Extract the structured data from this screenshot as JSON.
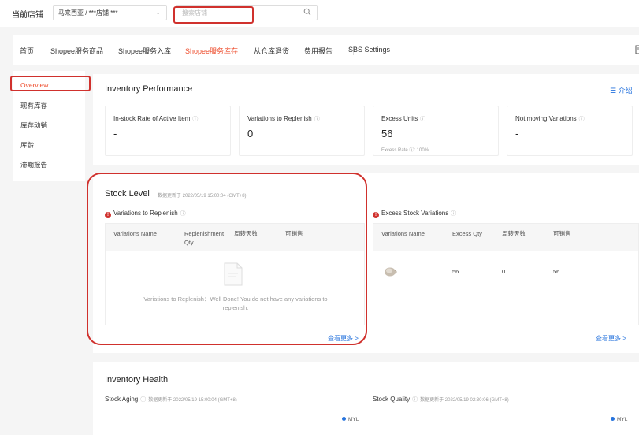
{
  "store_bar": {
    "label": "当前店铺",
    "store_value": "马来西亚 / ***店铺 ***",
    "search_placeholder": "搜索店铺"
  },
  "nav": {
    "tabs": [
      "首页",
      "Shopee服务商品",
      "Shopee服务入库",
      "Shopee服务库存",
      "从仓库退货",
      "费用报告",
      "SBS Settings"
    ],
    "active_tab": "Shopee服务库存"
  },
  "sidebar": {
    "items": [
      "Overview",
      "现有库存",
      "库存动销",
      "库龄",
      "滞期报告"
    ],
    "active_item": "Overview"
  },
  "performance": {
    "title": "Inventory Performance",
    "intro_link": "介绍",
    "metrics": [
      {
        "label": "In-stock Rate of Active Item",
        "value": "-"
      },
      {
        "label": "Variations to Replenish",
        "value": "0"
      },
      {
        "label": "Excess Units",
        "value": "56",
        "sub": "Excess Rate ⓘ: 100%"
      },
      {
        "label": "Not moving Variations",
        "value": "-"
      }
    ]
  },
  "stock_level": {
    "title": "Stock Level",
    "updated": "数据更新于 2022/05/19 15:00:04 (GMT+8)",
    "replenish": {
      "heading": "Variations to Replenish",
      "columns": [
        "Variations Name",
        "Replenishment Qty",
        "周转天数",
        "可销售"
      ],
      "empty_text": "Variations to Replenish：Well Done! You do not have any variations to replenish.",
      "more_link": "查看更多 >"
    },
    "excess": {
      "heading": "Excess Stock Variations",
      "columns": [
        "Variations Name",
        "Excess Qty",
        "周转天数",
        "可销售"
      ],
      "rows": [
        {
          "excess_qty": "56",
          "turnover_days": "0",
          "sellable": "56"
        }
      ],
      "more_link": "查看更多 >"
    }
  },
  "health": {
    "title": "Inventory Health",
    "stock_aging": {
      "label": "Stock Aging",
      "updated": "数据更新于 2022/05/19 15:00:04 (GMT+8)",
      "legend": "MYL"
    },
    "stock_quality": {
      "label": "Stock Quality",
      "updated": "数据更新于 2022/05/19 02:30:06 (GMT+8)",
      "legend": "MYL"
    }
  },
  "colors": {
    "accent": "#ee4d2d",
    "link": "#2673dd",
    "highlight_outline": "#d0312d"
  }
}
